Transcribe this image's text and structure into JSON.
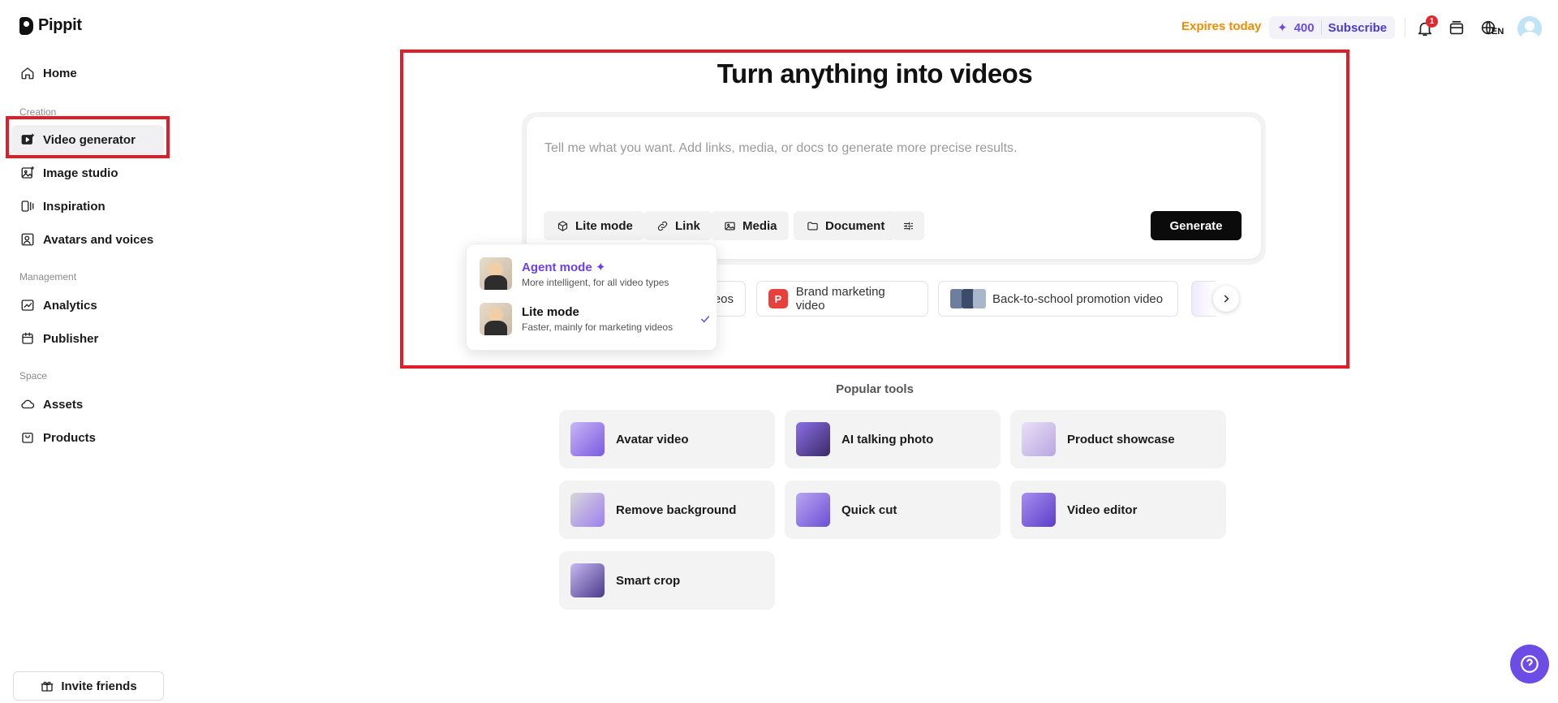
{
  "app": {
    "name": "Pippit"
  },
  "sidebar": {
    "home": "Home",
    "sections": {
      "creation": "Creation",
      "management": "Management",
      "space": "Space"
    },
    "items": [
      {
        "label": "Video generator",
        "icon": "video-generator-icon"
      },
      {
        "label": "Image studio",
        "icon": "image-studio-icon"
      },
      {
        "label": "Inspiration",
        "icon": "inspiration-icon"
      },
      {
        "label": "Avatars and voices",
        "icon": "avatar-voice-icon"
      },
      {
        "label": "Analytics",
        "icon": "chart-icon"
      },
      {
        "label": "Publisher",
        "icon": "calendar-icon"
      },
      {
        "label": "Assets",
        "icon": "cloud-icon"
      },
      {
        "label": "Products",
        "icon": "bag-icon"
      }
    ],
    "invite_label": "Invite friends"
  },
  "topbar": {
    "expires": "Expires today",
    "credits": "400",
    "subscribe": "Subscribe",
    "notification_count": "1",
    "language": "EN"
  },
  "main": {
    "title": "Turn anything into videos",
    "prompt_placeholder": "Tell me what you want. Add links, media, or docs to generate more precise results.",
    "chips": {
      "mode": "Lite mode",
      "link": "Link",
      "media": "Media",
      "document": "Document"
    },
    "generate": "Generate",
    "suggestions": [
      {
        "label": "eos"
      },
      {
        "label": "Brand marketing video",
        "badge": "P"
      },
      {
        "label": "Back-to-school promotion video"
      }
    ],
    "mode_menu": [
      {
        "title": "Agent mode",
        "desc": "More intelligent, for all video types",
        "selected": false
      },
      {
        "title": "Lite mode",
        "desc": "Faster, mainly for marketing videos",
        "selected": true
      }
    ]
  },
  "popular_tools": {
    "title": "Popular tools",
    "items": [
      "Avatar video",
      "AI talking photo",
      "Product showcase",
      "Remove background",
      "Quick cut",
      "Video editor",
      "Smart crop"
    ]
  },
  "colors": {
    "accent": "#6b4de6",
    "expires": "#f08c00",
    "highlight": "#e11d2a"
  }
}
